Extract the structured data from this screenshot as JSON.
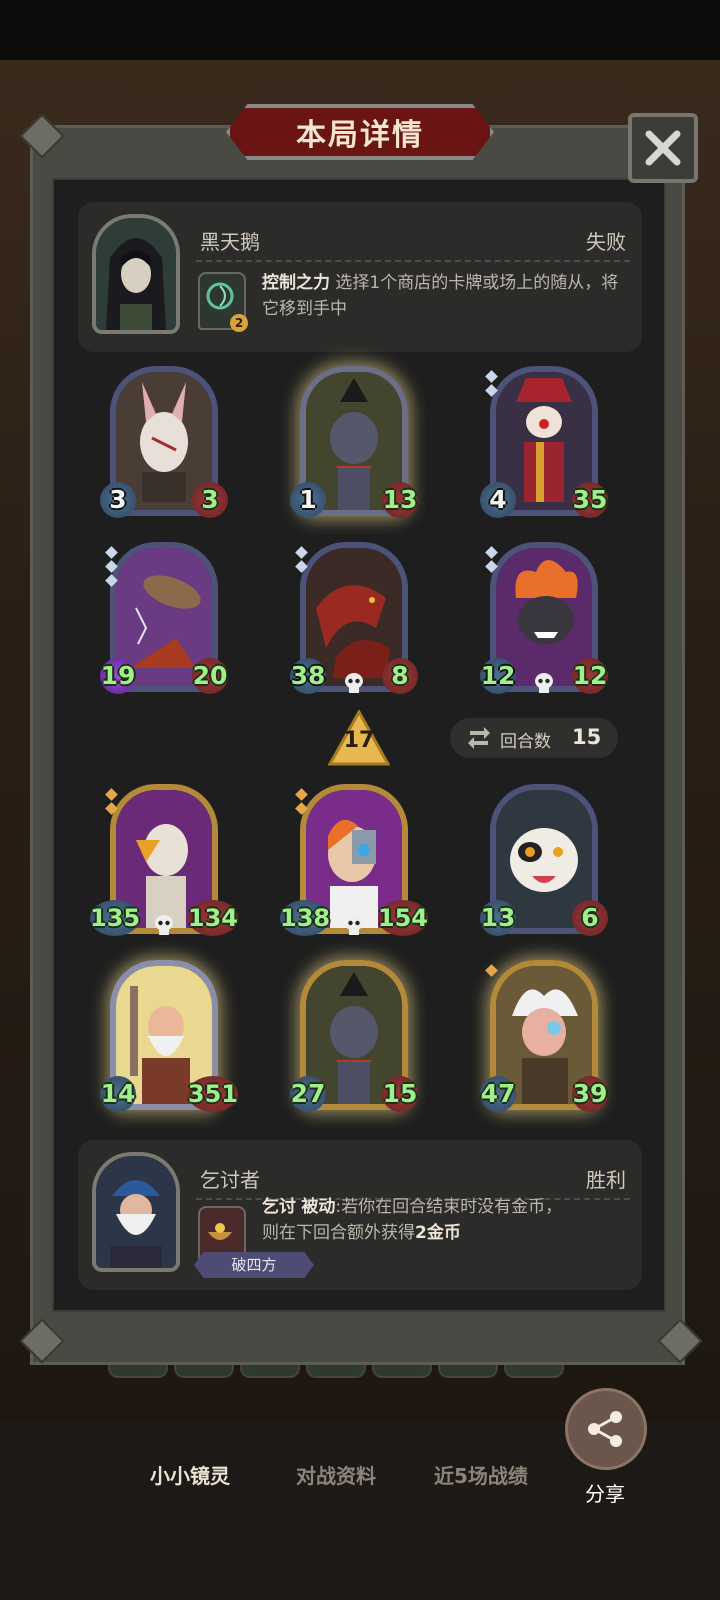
{
  "dialog": {
    "title": "本局详情",
    "close_icon": "close-icon"
  },
  "opponent": {
    "name": "黑天鹅",
    "result": "失败",
    "skill_name": "控制之力",
    "skill_desc": "选择1个商店的卡牌或场上的随从，将它移到手中",
    "skill_level": "2"
  },
  "opponent_board": [
    {
      "attack": "3",
      "health": "3",
      "frame": "silver"
    },
    {
      "attack": "1",
      "health": "13",
      "frame": "silver",
      "glow": true
    },
    {
      "attack": "4",
      "health": "35",
      "frame": "silver"
    },
    {
      "attack": "19",
      "health": "20",
      "frame": "silver"
    },
    {
      "attack": "38",
      "health": "8",
      "frame": "silver"
    },
    {
      "attack": "12",
      "health": "12",
      "frame": "silver"
    }
  ],
  "tavern_tier": "17",
  "round": {
    "label": "回合数",
    "value": "15"
  },
  "player_board": [
    {
      "attack": "135",
      "health": "134",
      "frame": "gold"
    },
    {
      "attack": "138",
      "health": "154",
      "frame": "gold"
    },
    {
      "attack": "13",
      "health": "6",
      "frame": "silver"
    },
    {
      "attack": "14",
      "health": "351",
      "frame": "gold",
      "glow": true
    },
    {
      "attack": "27",
      "health": "15",
      "frame": "gold",
      "glow": true
    },
    {
      "attack": "47",
      "health": "39",
      "frame": "gold",
      "glow": true
    }
  ],
  "player": {
    "name": "乞讨者",
    "result": "胜利",
    "skill_name": "乞讨",
    "skill_type": "被动",
    "skill_desc_1": "若你在回合结束时没有金币，",
    "skill_desc_2": "则在下回合额外获得",
    "skill_desc_bold": "2金币",
    "tag": "破四方"
  },
  "bottom_tabs": [
    {
      "label": "小小镜灵",
      "active": true
    },
    {
      "label": "对战资料",
      "active": false
    },
    {
      "label": "近5场战绩",
      "active": false
    }
  ],
  "share": {
    "label": "分享",
    "icon": "share-icon"
  }
}
